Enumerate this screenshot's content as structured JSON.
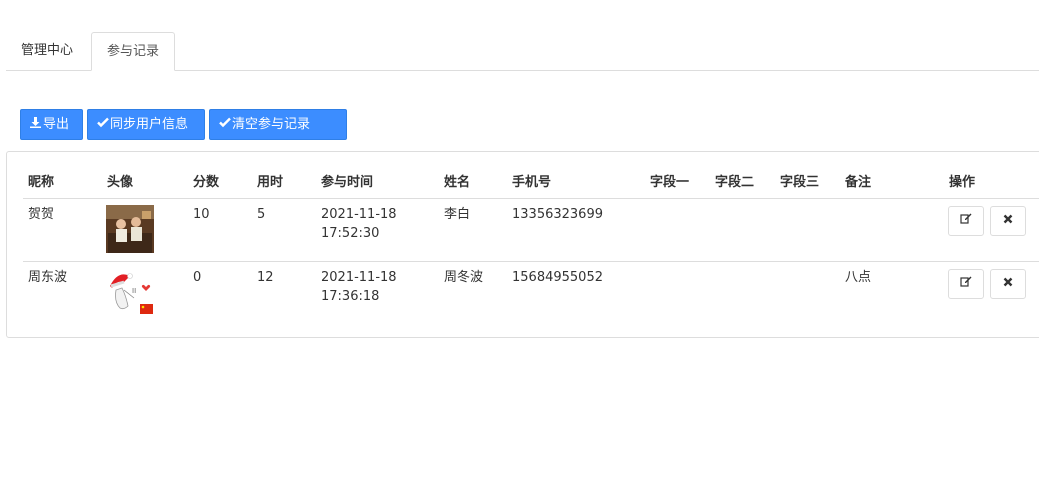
{
  "tabs": [
    {
      "label": "管理中心"
    },
    {
      "label": "参与记录"
    }
  ],
  "toolbar": {
    "export_label": "导出",
    "sync_label": "同步用户信息",
    "clear_label": "清空参与记录"
  },
  "table": {
    "headers": [
      "昵称",
      "头像",
      "分数",
      "用时",
      "参与时间",
      "姓名",
      "手机号",
      "字段一",
      "字段二",
      "字段三",
      "备注",
      "操作"
    ],
    "rows": [
      {
        "nickname": "贺贺",
        "score": "10",
        "duration": "5",
        "time_date": "2021-11-18",
        "time_clock": "17:52:30",
        "name": "李白",
        "phone": "13356323699",
        "field1": "",
        "field2": "",
        "field3": "",
        "remark": ""
      },
      {
        "nickname": "周东波",
        "score": "0",
        "duration": "12",
        "time_date": "2021-11-18",
        "time_clock": "17:36:18",
        "name": "周冬波",
        "phone": "15684955052",
        "field1": "",
        "field2": "",
        "field3": "",
        "remark": "八点"
      }
    ]
  },
  "colors": {
    "primary": "#3c8dff",
    "border": "#dddddd"
  }
}
